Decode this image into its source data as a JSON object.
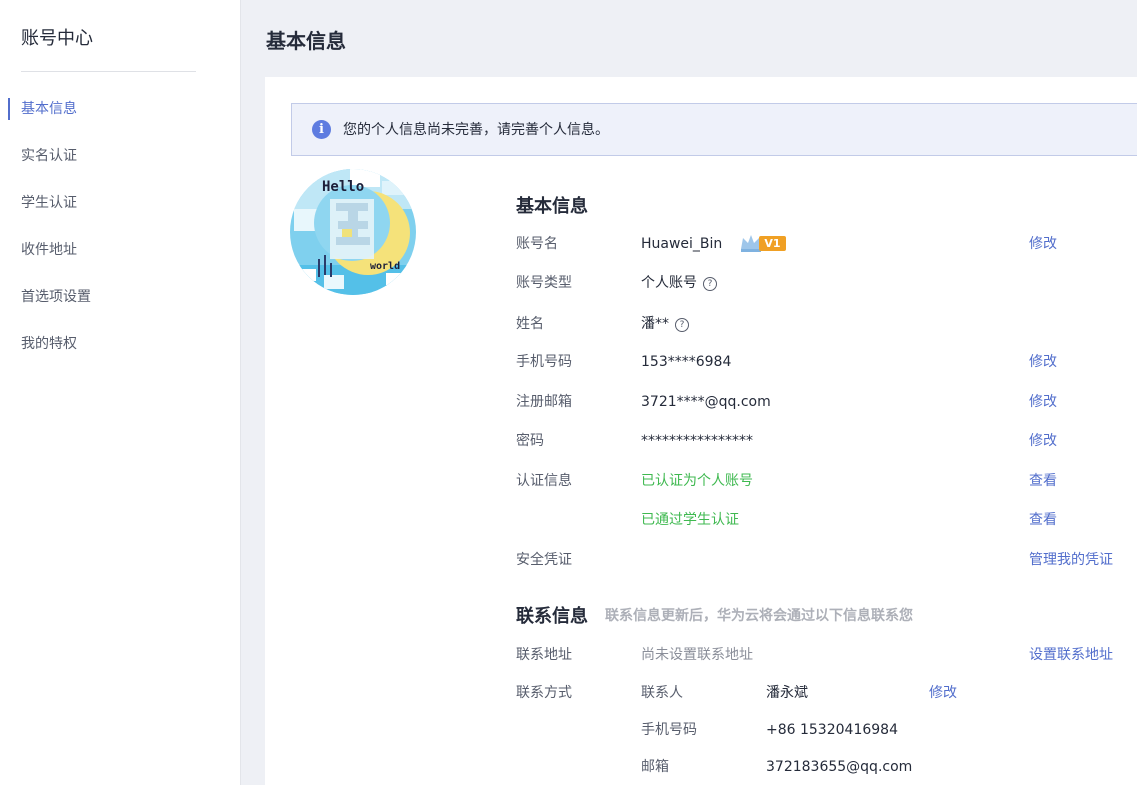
{
  "sidebar": {
    "title": "账号中心",
    "items": [
      {
        "label": "基本信息",
        "active": true
      },
      {
        "label": "实名认证"
      },
      {
        "label": "学生认证"
      },
      {
        "label": "收件地址"
      },
      {
        "label": "首选项设置"
      },
      {
        "label": "我的特权"
      }
    ]
  },
  "page": {
    "title": "基本信息"
  },
  "alert": {
    "icon": "info-icon",
    "text": "您的个人信息尚未完善，请完善个人信息。"
  },
  "avatar": {
    "text_top": "Hello",
    "text_bottom": "world"
  },
  "basic": {
    "title": "基本信息",
    "account_name": {
      "label": "账号名",
      "value": "Huawei_Bin",
      "badge": "V1",
      "action": "修改"
    },
    "account_type": {
      "label": "账号类型",
      "value": "个人账号"
    },
    "name": {
      "label": "姓名",
      "value": "潘**"
    },
    "phone": {
      "label": "手机号码",
      "value": "153****6984",
      "action": "修改"
    },
    "email": {
      "label": "注册邮箱",
      "value": "3721****@qq.com",
      "action": "修改"
    },
    "password": {
      "label": "密码",
      "value": "****************",
      "action": "修改"
    },
    "cert": {
      "label": "认证信息",
      "value1": "已认证为个人账号",
      "action1": "查看",
      "value2": "已通过学生认证",
      "action2": "查看"
    },
    "security": {
      "label": "安全凭证",
      "action": "管理我的凭证"
    }
  },
  "contact": {
    "title": "联系信息",
    "subtitle": "联系信息更新后，华为云将会通过以下信息联系您",
    "address": {
      "label": "联系地址",
      "value": "尚未设置联系地址",
      "action": "设置联系地址"
    },
    "method": {
      "label": "联系方式",
      "person_label": "联系人",
      "person": "潘永斌",
      "action": "修改",
      "phone_label": "手机号码",
      "phone": "+86 15320416984",
      "email_label": "邮箱",
      "email": "372183655@qq.com"
    }
  },
  "colors": {
    "accent": "#526ecc",
    "success": "#3fb950",
    "badge": "#f0a024"
  }
}
